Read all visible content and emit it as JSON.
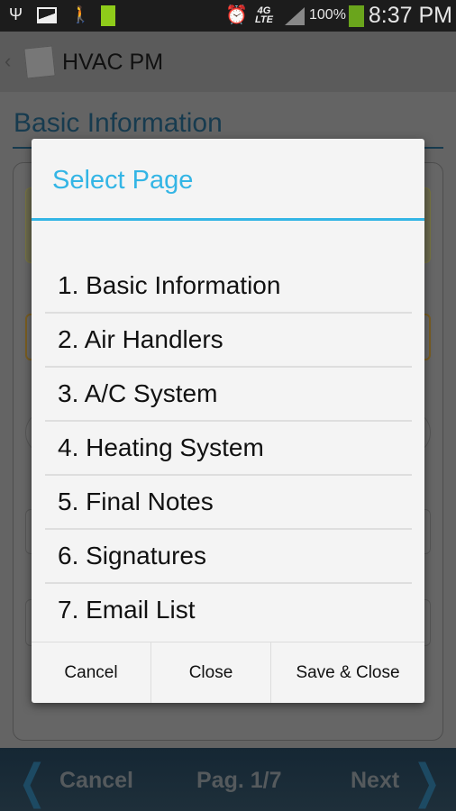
{
  "status_bar": {
    "time": "8:37 PM",
    "battery_percent": "100%",
    "network": "4G LTE",
    "icons": [
      "usb-icon",
      "image-icon",
      "walking-icon",
      "battery-charged-icon",
      "alarm-icon",
      "4g-lte-icon",
      "signal-icon",
      "battery-icon"
    ]
  },
  "action_bar": {
    "app_name": "HVAC PM"
  },
  "page": {
    "title": "Basic Information"
  },
  "dialog": {
    "title": "Select Page",
    "accent": "#33b5e5",
    "items": [
      "1. Basic Information",
      "2. Air Handlers",
      "3. A/C System",
      "4. Heating System",
      "5. Final Notes",
      "6. Signatures",
      "7. Email List"
    ],
    "buttons": {
      "cancel": "Cancel",
      "close": "Close",
      "save_close": "Save & Close"
    }
  },
  "bottom_nav": {
    "cancel": "Cancel",
    "page_indicator": "Pag. 1/7",
    "next": "Next"
  }
}
